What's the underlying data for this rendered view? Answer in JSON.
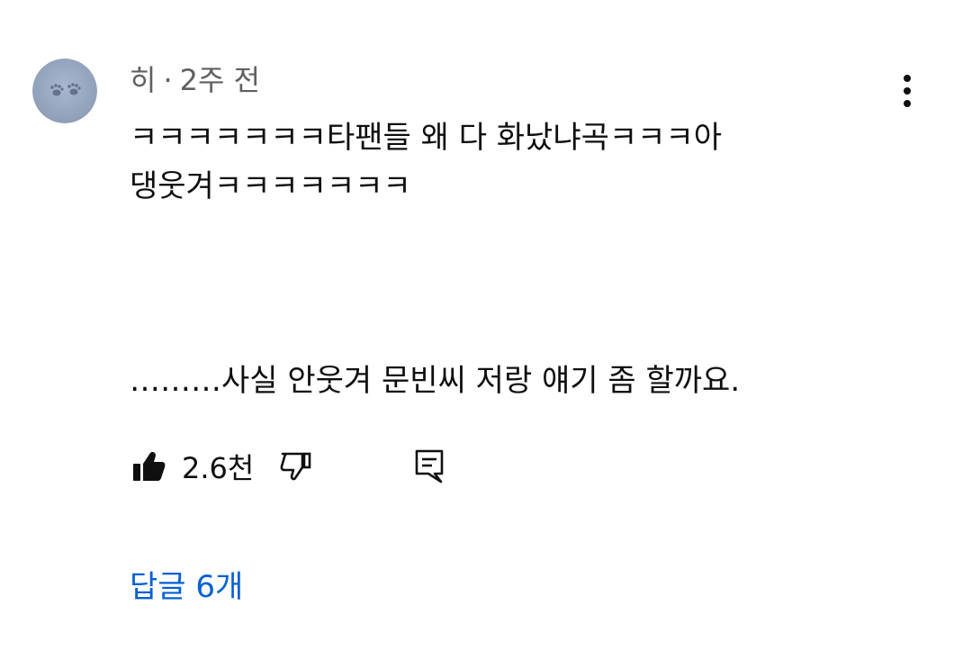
{
  "comment": {
    "author": "히",
    "separator": "·",
    "time": "2주 전",
    "lines": [
      "ㅋㅋㅋㅋㅋㅋㅋ타팬들 왜 다 화났냐곡ㅋㅋㅋ아",
      "댕웃겨ㅋㅋㅋㅋㅋㅋㅋ",
      "………사실 안웃겨 문빈씨 저랑 얘기 좀 할까요."
    ],
    "avatar_icon": "paw-print-avatar"
  },
  "actions": {
    "like_count": "2.6천",
    "like_icon": "thumbs-up-filled-icon",
    "dislike_icon": "thumbs-down-icon",
    "reply_icon": "comment-reply-icon"
  },
  "more_icon": "more-vertical-icon",
  "replies_label": "답글 6개",
  "colors": {
    "meta": "#606060",
    "text": "#0f0f0f",
    "link": "#065fd4"
  }
}
